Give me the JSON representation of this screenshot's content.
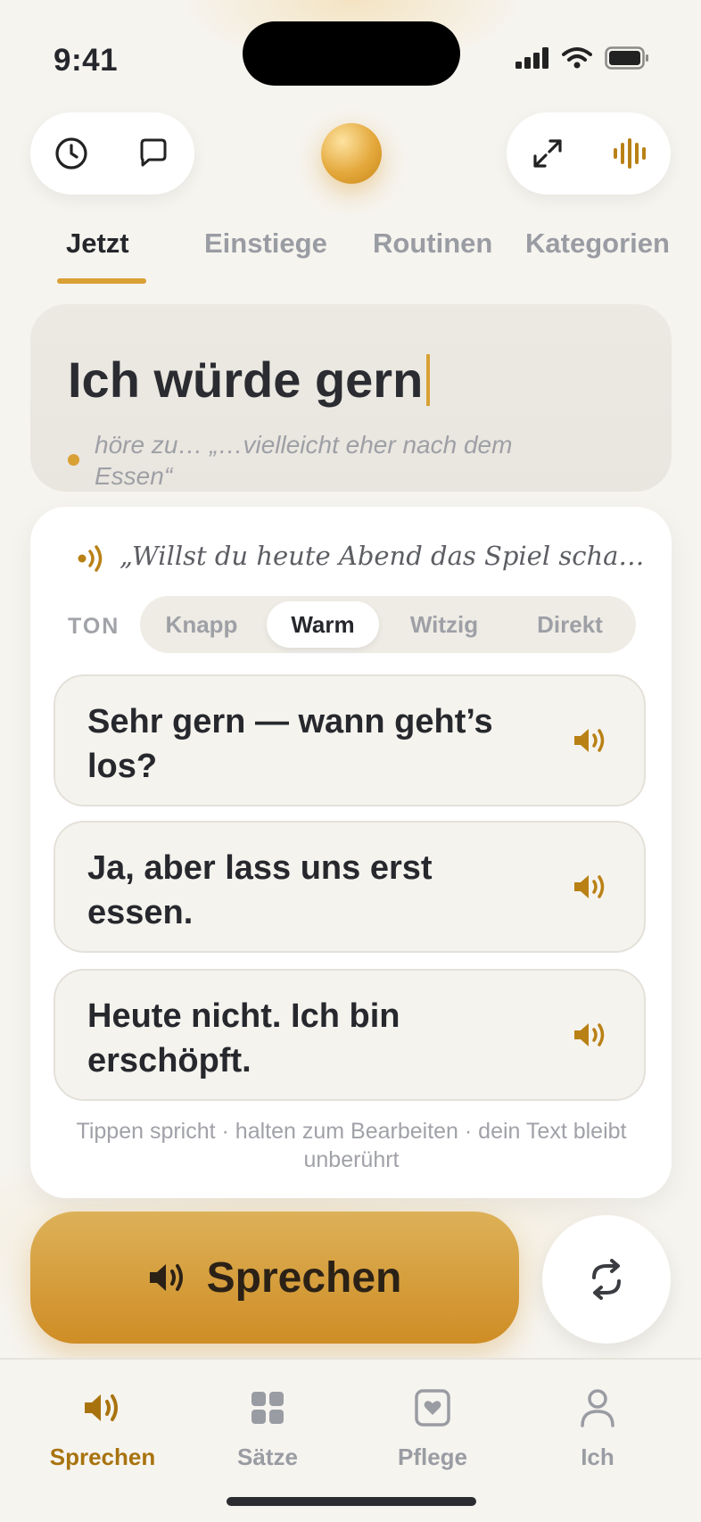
{
  "status_bar": {
    "time": "9:41"
  },
  "tabs": [
    {
      "label": "Jetzt",
      "active": true
    },
    {
      "label": "Einstiege",
      "active": false
    },
    {
      "label": "Routinen",
      "active": false
    },
    {
      "label": "Kategorien",
      "active": false
    }
  ],
  "composer": {
    "text": "Ich würde gern",
    "listening_text": "höre zu… „…vielleicht eher nach dem Essen“"
  },
  "suggestions": {
    "heard_quote": "„Willst du heute Abend das Spiel schauen?“",
    "tone_label": "TON",
    "tones": [
      "Knapp",
      "Warm",
      "Witzig",
      "Direkt"
    ],
    "selected_tone": "Warm",
    "replies": [
      "Sehr gern — wann geht’s los?",
      "Ja, aber lass uns erst essen.",
      "Heute nicht. Ich bin erschöpft."
    ],
    "hint": "Tippen spricht · halten zum Bearbeiten · dein Text bleibt unberührt"
  },
  "actions": {
    "speak_label": "Sprechen"
  },
  "bottom_nav": [
    {
      "label": "Sprechen",
      "icon": "speaker-icon",
      "active": true
    },
    {
      "label": "Sätze",
      "icon": "grid-icon",
      "active": false
    },
    {
      "label": "Pflege",
      "icon": "heart-card-icon",
      "active": false
    },
    {
      "label": "Ich",
      "icon": "person-icon",
      "active": false
    }
  ],
  "colors": {
    "accent": "#d9a035",
    "accent_dark": "#a8730f",
    "background": "#f6f4ef",
    "text": "#25272c",
    "muted": "#9a9ca3"
  }
}
